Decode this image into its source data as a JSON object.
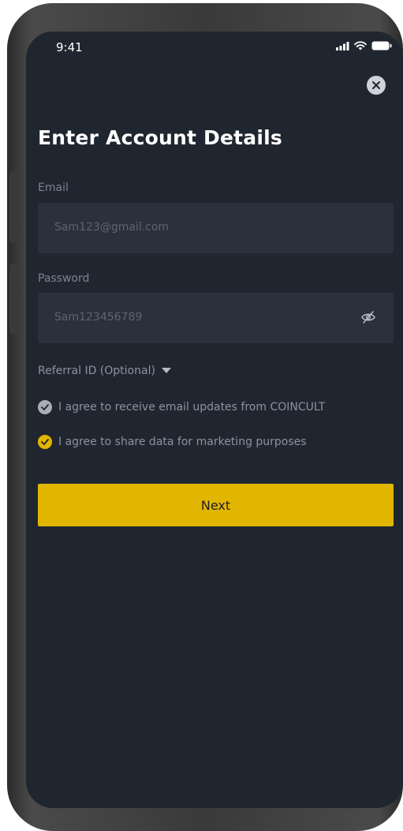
{
  "status_bar": {
    "time": "9:41"
  },
  "form": {
    "title": "Enter Account Details",
    "email_label": "Email",
    "email_placeholder": "Sam123@gmail.com",
    "password_label": "Password",
    "password_placeholder": "Sam123456789",
    "referral_label": "Referral ID (Optional)",
    "checkbox_email_updates": "I agree to receive email updates from COINCULT",
    "checkbox_marketing": "I agree to share data for marketing purposes",
    "next_label": "Next"
  },
  "icons": {
    "close": "close-icon",
    "eye_off": "eye-off-icon",
    "dropdown": "caret-down-icon",
    "check": "check-icon"
  },
  "colors": {
    "screen_bg": "#20262f",
    "input_bg": "#2a313c",
    "accent": "#e2b600",
    "checked_gray": "#a9aeb6"
  },
  "checkboxes": {
    "email_updates_checked": true,
    "marketing_checked": true
  }
}
